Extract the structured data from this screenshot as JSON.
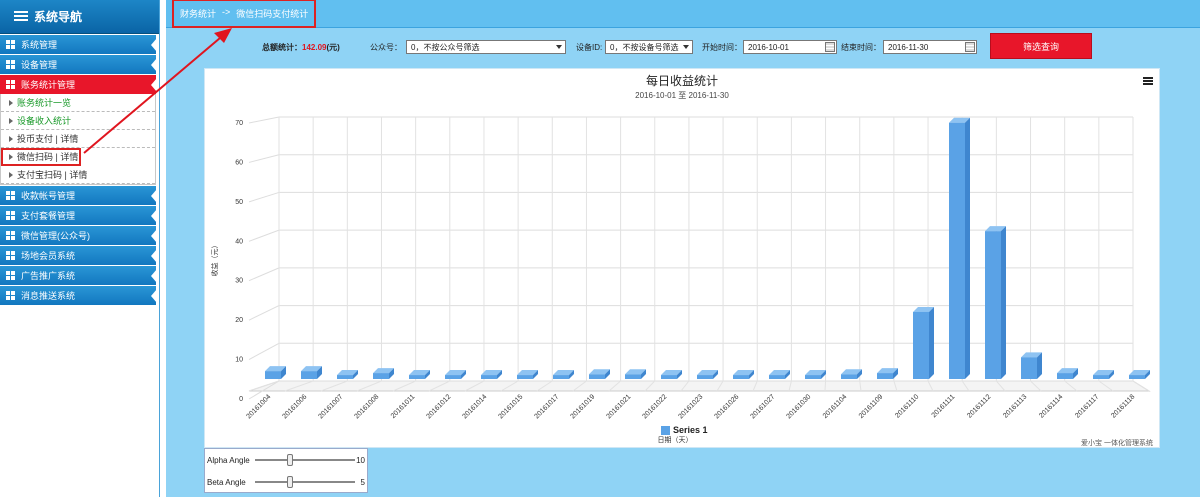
{
  "sidebar": {
    "title": "系统导航",
    "items": [
      {
        "label": "系统管理"
      },
      {
        "label": "设备管理"
      },
      {
        "label": "账务统计管理",
        "active": true
      }
    ],
    "subitems": [
      {
        "label": "账务统计一览",
        "style": "green"
      },
      {
        "label": "设备收入统计",
        "style": "green"
      },
      {
        "label": "投币支付 | 详情",
        "style": "normal"
      },
      {
        "label": "微信扫码 | 详情",
        "style": "boxed"
      },
      {
        "label": "支付宝扫码 | 详情",
        "style": "normal"
      }
    ],
    "more_items": [
      {
        "label": "收款帐号管理"
      },
      {
        "label": "支付套餐管理"
      },
      {
        "label": "微信管理(公众号)"
      },
      {
        "label": "场地会员系统"
      },
      {
        "label": "广告推广系统"
      },
      {
        "label": "消息推送系统"
      }
    ]
  },
  "breadcrumb": {
    "root": "财务统计",
    "sep": "->",
    "current": "微信扫码支付统计"
  },
  "filters": {
    "total_label": "总额统计：",
    "total_value": "142.09",
    "total_unit": "(元)",
    "account_label": "公众号：",
    "account_value": "0，不按公众号筛选",
    "device_label": "设备ID:",
    "device_value": "0，不按设备号筛选",
    "start_label": "开始时间：",
    "start_value": "2016-10-01",
    "end_label": "结束时间：",
    "end_value": "2016-11-30",
    "button_label": "筛选查询"
  },
  "chart_data": {
    "type": "bar",
    "title": "每日收益统计",
    "subtitle": "2016-10-01 至 2016-11-30",
    "xlabel": "日期（天）",
    "ylabel": "收益（元）",
    "ylim": [
      0,
      70
    ],
    "yticks": [
      "0",
      "10",
      "20",
      "30",
      "40",
      "50",
      "60",
      "70"
    ],
    "categories": [
      "20161004",
      "20161006",
      "20161007",
      "20161008",
      "20161011",
      "20161012",
      "20161014",
      "20161015",
      "20161017",
      "20161019",
      "20161021",
      "20161022",
      "20161023",
      "20161026",
      "20161027",
      "20161030",
      "20161104",
      "20161109",
      "20161110",
      "20161111",
      "20161112",
      "20161113",
      "20161114",
      "20161117",
      "20161118"
    ],
    "series": [
      {
        "name": "Series 1",
        "values": [
          2,
          2,
          1,
          1.5,
          1,
          1,
          1,
          1,
          1,
          1.2,
          1.2,
          1,
          1,
          1,
          1,
          1,
          1.2,
          1.5,
          17,
          65,
          37.5,
          5.5,
          1.5,
          1,
          1
        ]
      }
    ],
    "legend": "Series 1",
    "credit": "爱小宝 一体化管理系统",
    "grid": true,
    "bar_color": "#5aa2e6"
  },
  "angles": {
    "alpha_label": "Alpha Angle",
    "alpha_value": "10",
    "beta_label": "Beta Angle",
    "beta_value": "5"
  }
}
